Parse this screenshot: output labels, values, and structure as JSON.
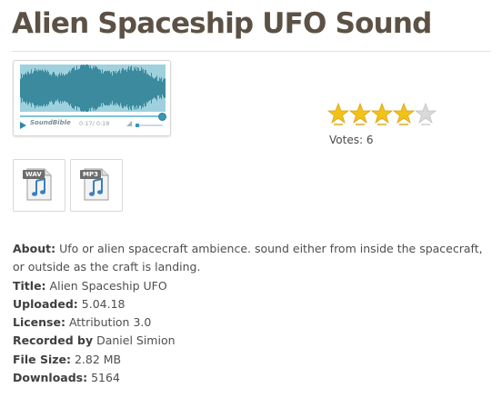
{
  "title": "Alien Spaceship UFO Sound",
  "player": {
    "brand": "SoundBible",
    "time": "0:17/ 0:18",
    "progress": 0.97,
    "volume": 0.15,
    "icons": [
      "play-icon",
      "volume-icon"
    ]
  },
  "rating": {
    "stars_filled": 4,
    "stars_total": 5,
    "votes_label": "Votes: 6"
  },
  "downloads": [
    {
      "format": "WAV",
      "icon": "music-note-icon"
    },
    {
      "format": "MP3",
      "icon": "music-note-icon"
    }
  ],
  "details": {
    "about_label": "About:",
    "about_value": "Ufo or alien spacecraft ambience. sound either from inside the spacecraft, or outside as the craft is landing.",
    "title_label": "Title:",
    "title_value": "Alien Spaceship UFO",
    "uploaded_label": "Uploaded:",
    "uploaded_value": "5.04.18",
    "license_label": "License:",
    "license_value": "Attribution 3.0",
    "recorded_label": "Recorded by",
    "recorded_value": "Daniel Simion",
    "filesize_label": "File Size:",
    "filesize_value": "2.82 MB",
    "downloads_label": "Downloads:",
    "downloads_value": "5164"
  },
  "colors": {
    "title": "#5c5145",
    "star_filled": "#f2c21a",
    "star_empty": "#d9d9d9",
    "waveform": "#3c8a9e",
    "waveform_bg": "#9ed1dd"
  }
}
